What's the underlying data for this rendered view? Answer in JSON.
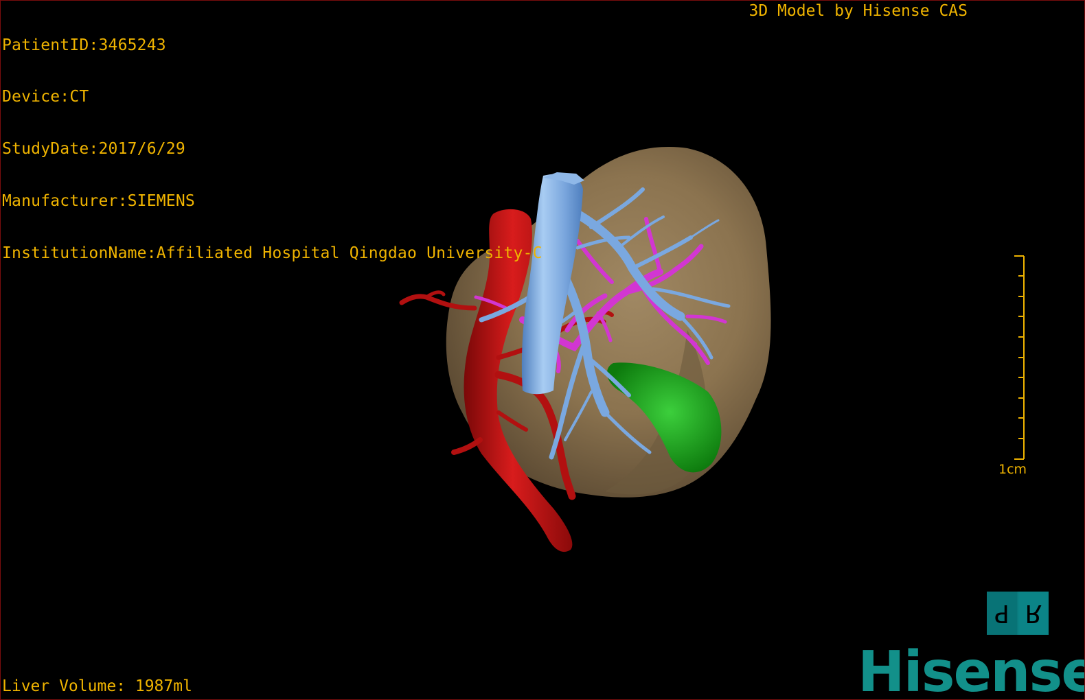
{
  "header": {
    "patient_id": "PatientID:3465243",
    "device": "Device:CT",
    "study_date": "StudyDate:2017/6/29",
    "manufacturer": "Manufacturer:SIEMENS",
    "institution": "InstitutionName:Affiliated Hospital Qingdao University-C"
  },
  "credit": "3D Model by Hisense CAS",
  "footer": {
    "liver_volume": "Liver Volume: 1987ml"
  },
  "scale": {
    "label": "1cm"
  },
  "orientation_cube": {
    "left_face": "P",
    "right_face": "R"
  },
  "brand": {
    "logo_text": "Hisense"
  },
  "colors": {
    "overlay_text": "#f0b400",
    "liver": "#8c7455",
    "hepatic_vein": "#7aa8e0",
    "portal_vein": "#d436d4",
    "artery": "#c01414",
    "gallbladder": "#1ea21e",
    "brand": "#12908a"
  }
}
